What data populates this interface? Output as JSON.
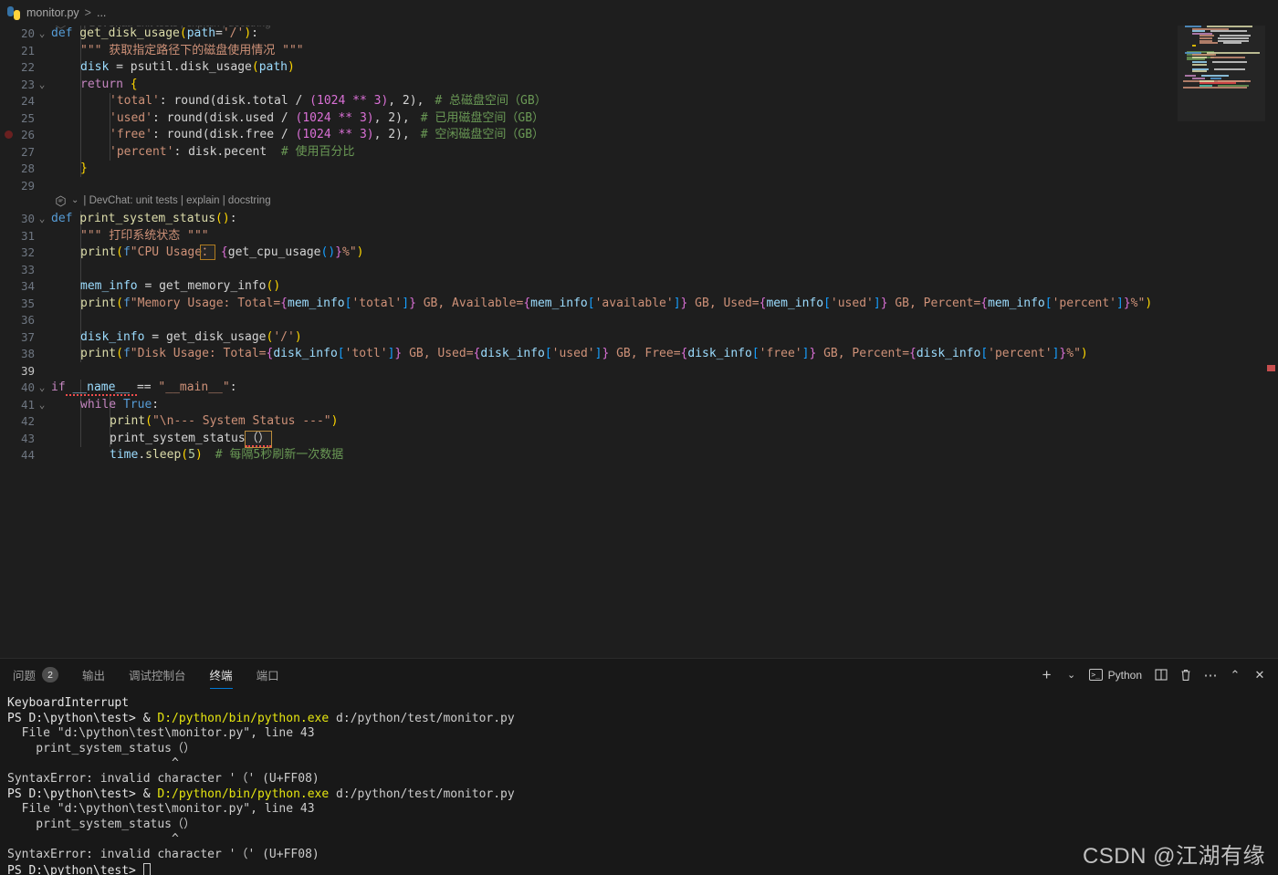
{
  "breadcrumb": {
    "file_icon": "python-file-icon",
    "file": "monitor.py",
    "separator": ">",
    "overflow": "..."
  },
  "editor": {
    "codelens": {
      "icon": "devchat-icon",
      "chevron": "⌄",
      "text": "| DevChat: unit tests | explain | docstring"
    },
    "lines": [
      {
        "no": "20",
        "fold": "⌄"
      },
      {
        "no": "21",
        "fold": ""
      },
      {
        "no": "22",
        "fold": ""
      },
      {
        "no": "23",
        "fold": "⌄"
      },
      {
        "no": "24",
        "fold": ""
      },
      {
        "no": "25",
        "fold": ""
      },
      {
        "no": "26",
        "fold": ""
      },
      {
        "no": "27",
        "fold": ""
      },
      {
        "no": "28",
        "fold": ""
      },
      {
        "no": "29",
        "fold": ""
      },
      {
        "no": "30",
        "fold": "⌄"
      },
      {
        "no": "31",
        "fold": ""
      },
      {
        "no": "32",
        "fold": ""
      },
      {
        "no": "33",
        "fold": ""
      },
      {
        "no": "34",
        "fold": ""
      },
      {
        "no": "35",
        "fold": ""
      },
      {
        "no": "36",
        "fold": ""
      },
      {
        "no": "37",
        "fold": ""
      },
      {
        "no": "38",
        "fold": ""
      },
      {
        "no": "39",
        "fold": ""
      },
      {
        "no": "40",
        "fold": "⌄"
      },
      {
        "no": "41",
        "fold": "⌄"
      },
      {
        "no": "42",
        "fold": ""
      },
      {
        "no": "43",
        "fold": ""
      },
      {
        "no": "44",
        "fold": ""
      }
    ],
    "code": {
      "l20_def": "def",
      "l20_name": " get_disk_usage",
      "l20_sig_open": "(",
      "l20_param": "path",
      "l20_eq": "=",
      "l20_default": "'/'",
      "l20_sig_close": ")",
      "l20_colon": ":",
      "l21": "\"\"\" 获取指定路径下的磁盘使用情况 \"\"\"",
      "l22_var": "disk",
      "l22_eq": " = ",
      "l22_call": "psutil.disk_usage",
      "l22_open": "(",
      "l22_arg": "path",
      "l22_close": ")",
      "l23_ret": "return",
      "l23_brace": " {",
      "l24_key": "'total'",
      "l24_mid": ": round(disk.total / ",
      "l24_grp": "(1024 ** 3)",
      "l24_tail": ", 2),",
      "l24_cmt": "# 总磁盘空间（GB）",
      "l25_key": "'used'",
      "l25_mid": ": round(disk.used / ",
      "l25_grp": "(1024 ** 3)",
      "l25_tail": ", 2),",
      "l25_cmt": "# 已用磁盘空间（GB）",
      "l26_key": "'free'",
      "l26_mid": ": round(disk.free / ",
      "l26_grp": "(1024 ** 3)",
      "l26_tail": ", 2),",
      "l26_cmt": "# 空闲磁盘空间（GB）",
      "l27_key": "'percent'",
      "l27_mid": ": disk.pecent  ",
      "l27_cmt": "# 使用百分比",
      "l28_brace": "}",
      "l30_def": "def",
      "l30_name": " print_system_status",
      "l30_parens": "()",
      "l30_colon": ":",
      "l31": "\"\"\" 打印系统状态 \"\"\"",
      "l32_fn": "print",
      "l32_open": "(",
      "l32_f": "f",
      "l32_q1": "\"",
      "l32_txt": "CPU Usage",
      "l32_badchar": "：",
      "l32_space": " ",
      "l32_brace_open": "{",
      "l32_expr": "get_cpu_usage",
      "l32_call": "()",
      "l32_brace_close": "}",
      "l32_pct": "%",
      "l32_q2": "\"",
      "l32_close": ")",
      "l34_var": "mem_info",
      "l34_eq": " = ",
      "l34_fn": "get_memory_info",
      "l34_call": "()",
      "l35_fn": "print",
      "l35_open": "(",
      "l35_f": "f",
      "l35_q1": "\"",
      "l35_t1": "Memory Usage: Total=",
      "l35_e1": "mem_info",
      "l35_k1": "'total'",
      "l35_t2": " GB, Available=",
      "l35_e2": "mem_info",
      "l35_k2": "'available'",
      "l35_t3": " GB, Used=",
      "l35_e3": "mem_info",
      "l35_k3": "'used'",
      "l35_t4": " GB, Percent=",
      "l35_e4": "mem_info",
      "l35_k4": "'percent'",
      "l35_pct": "%",
      "l35_q2": "\"",
      "l35_close": ")",
      "l37_var": "disk_info",
      "l37_eq": " = ",
      "l37_fn": "get_disk_usage",
      "l37_open": "(",
      "l37_arg": "'/'",
      "l37_close": ")",
      "l38_fn": "print",
      "l38_open": "(",
      "l38_f": "f",
      "l38_q1": "\"",
      "l38_t1": "Disk Usage: Total=",
      "l38_e1": "disk_info",
      "l38_k1": "'totl'",
      "l38_t2": " GB, Used=",
      "l38_e2": "disk_info",
      "l38_k2": "'used'",
      "l38_t3": " GB, Free=",
      "l38_e3": "disk_info",
      "l38_k3": "'free'",
      "l38_t4": " GB, Percent=",
      "l38_e4": "disk_info",
      "l38_k4": "'percent'",
      "l38_pct": "%",
      "l38_q2": "\"",
      "l38_close": ")",
      "l40_if": "if",
      "l40_name": " __name__ ",
      "l40_eq": "== ",
      "l40_main": "\"__main__\"",
      "l40_colon": ":",
      "l41_while": "while",
      "l41_true": " True",
      "l41_colon": ":",
      "l42_fn": "print",
      "l42_open": "(",
      "l42_str": "\"\\n--- System Status ---\"",
      "l42_close": ")",
      "l43_fn": "print_system_status",
      "l43_badparens": "（）",
      "l44_mod": "time",
      "l44_dot": ".",
      "l44_fn": "sleep",
      "l44_open": "(",
      "l44_num": "5",
      "l44_close": ")",
      "l44_cmt": "# 每隔5秒刷新一次数据"
    }
  },
  "panel": {
    "tabs": [
      {
        "label": "问题",
        "badge": "2",
        "active": false
      },
      {
        "label": "输出",
        "badge": "",
        "active": false
      },
      {
        "label": "调试控制台",
        "badge": "",
        "active": false
      },
      {
        "label": "终端",
        "badge": "",
        "active": true
      },
      {
        "label": "端口",
        "badge": "",
        "active": false
      }
    ],
    "actions": {
      "new_terminal": "+",
      "new_terminal_dropdown": "⌄",
      "shell_icon": ">_",
      "shell_name": "Python",
      "split": "split-icon",
      "kill": "🗑",
      "more": "⋯",
      "maximize": "⌃",
      "close": "✕"
    }
  },
  "terminal": {
    "lines": [
      [
        {
          "t": "KeyboardInterrupt",
          "c": "t-white"
        }
      ],
      [
        {
          "t": "PS D:\\python\\test> & ",
          "c": "t-white"
        },
        {
          "t": "D:/python/bin/python.exe",
          "c": "t-yellow"
        },
        {
          "t": " d:/python/test/monitor.py",
          "c": "t-grey"
        }
      ],
      [
        {
          "t": "  File \"d:\\python\\test\\monitor.py\", line 43",
          "c": "t-grey"
        }
      ],
      [
        {
          "t": "    print_system_status（）",
          "c": "t-grey"
        }
      ],
      [
        {
          "t": "                       ^",
          "c": "t-grey"
        }
      ],
      [
        {
          "t": "SyntaxError: invalid character '（' (U+FF08)",
          "c": "t-grey"
        }
      ],
      [
        {
          "t": "PS D:\\python\\test> & ",
          "c": "t-white"
        },
        {
          "t": "D:/python/bin/python.exe",
          "c": "t-yellow"
        },
        {
          "t": " d:/python/test/monitor.py",
          "c": "t-grey"
        }
      ],
      [
        {
          "t": "  File \"d:\\python\\test\\monitor.py\", line 43",
          "c": "t-grey"
        }
      ],
      [
        {
          "t": "    print_system_status（）",
          "c": "t-grey"
        }
      ],
      [
        {
          "t": "                       ^",
          "c": "t-grey"
        }
      ],
      [
        {
          "t": "SyntaxError: invalid character '（' (U+FF08)",
          "c": "t-grey"
        }
      ],
      [
        {
          "t": "PS D:\\python\\test> ",
          "c": "t-white"
        }
      ]
    ]
  },
  "watermark": "CSDN @江湖有缘",
  "colors": {
    "editor_bg": "#1e1e1e",
    "panel_bg": "#181818",
    "accent": "#0078d4",
    "error": "#f14c4c",
    "keyword": "#569CD6",
    "function": "#DCDCAA",
    "string": "#CE9178",
    "comment": "#6A9955",
    "number": "#B5CEA8",
    "variable": "#9CDCFE"
  }
}
